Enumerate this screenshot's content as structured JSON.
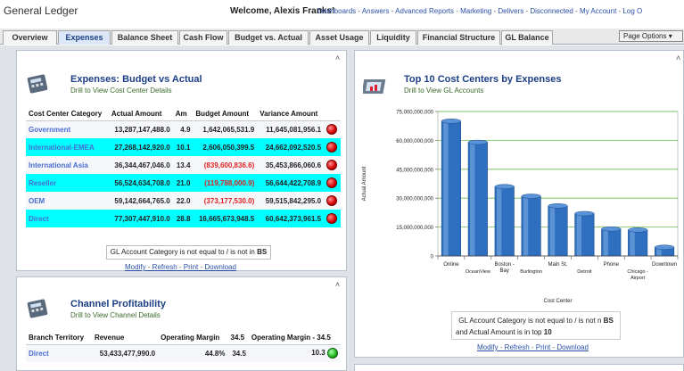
{
  "app": {
    "title": "General Ledger",
    "welcome": "Welcome, Alexis Franks!",
    "links": [
      "Dashboards",
      "Answers",
      "Advanced Reports",
      "Marketing",
      "Delivers",
      "Disconnected",
      "My Account",
      "Log O"
    ]
  },
  "tabs": [
    {
      "label": "Overview"
    },
    {
      "label": "Expenses"
    },
    {
      "label": "Balance Sheet"
    },
    {
      "label": "Cash Flow"
    },
    {
      "label": "Budget vs. Actual"
    },
    {
      "label": "Asset Usage"
    },
    {
      "label": "Liquidity"
    },
    {
      "label": "Financial Structure"
    },
    {
      "label": "GL Balance"
    }
  ],
  "page_options": "Page Options",
  "budget_panel": {
    "title": "Expenses: Budget vs Actual",
    "subtitle": "Drill to View Cost Center Details",
    "headers": [
      "Cost Center Category",
      "Actual Amount",
      "Am",
      "Budget Amount",
      "Variance Amount"
    ],
    "rows": [
      {
        "cat": "Government",
        "actual": "13,287,147,488.0",
        "am": "4.9",
        "budget": "1,642,065,531.9",
        "variance": "11,645,081,956.1"
      },
      {
        "cat": "International-EMEA",
        "actual": "27,268,142,920.0",
        "am": "10.1",
        "budget": "2,606,050,399.5",
        "variance": "24,662,092,520.5"
      },
      {
        "cat": "International Asia",
        "actual": "36,344,467,046.0",
        "am": "13.4",
        "budget": "(839,600,836.6)",
        "variance": "35,453,866,060.6"
      },
      {
        "cat": "Reseller",
        "actual": "56,524,634,708.0",
        "am": "21.0",
        "budget": "(119,788,000.9)",
        "variance": "56,644,422,708.9"
      },
      {
        "cat": "OEM",
        "actual": "59,142,664,765.0",
        "am": "22.0",
        "budget": "(373,177,530.0)",
        "variance": "59,515,842,295.0"
      },
      {
        "cat": "Direct",
        "actual": "77,307,447,910.0",
        "am": "28.8",
        "budget": "16,665,673,948.5",
        "variance": "60,642,373,961.5"
      }
    ],
    "filter_text": "GL Account Category is not equal to / is not in",
    "filter_value": "BS",
    "actions": [
      "Modify",
      "Refresh",
      "Print",
      "Download"
    ]
  },
  "channel_panel": {
    "title": "Channel Profitability",
    "subtitle": "Drill to View Channel Details",
    "headers": [
      "Branch Territory",
      "Revenue",
      "Operating Margin",
      "34.5",
      "Operating Margin - 34.5"
    ],
    "rows": [
      {
        "cat": "Direct",
        "revenue": "53,433,477,990.0",
        "om": "44.8%",
        "v": "34.5",
        "omv": "10.3"
      }
    ]
  },
  "cost_panel": {
    "title": "Top 10 Cost Centers by Expenses",
    "subtitle": "Drill to View GL Accounts",
    "filter_line1": "GL Account Category is not equal to / is not n",
    "filter_value1": "BS",
    "filter_line2": "and Actual Amount is in top",
    "filter_value2": "10",
    "actions": [
      "Modify",
      "Refresh",
      "Print",
      "Download"
    ]
  },
  "chart_data": {
    "type": "bar",
    "title": "",
    "xlabel": "Cost Center",
    "ylabel": "Actual Amount",
    "ylim": [
      0,
      75000000000
    ],
    "yticks": [
      "0",
      "15,000,000,000",
      "30,000,000,000",
      "45,000,000,000",
      "60,000,000,000",
      "75,000,000,000"
    ],
    "categories_upper": [
      "Online",
      "Boston - Bay",
      "Main St.",
      "Phone",
      "Downtown"
    ],
    "categories_lower": [
      "OceanView",
      "Burlington",
      "Detroit",
      "Chicago - Airport"
    ],
    "values": [
      70000000000,
      59000000000,
      36000000000,
      31000000000,
      26000000000,
      22000000000,
      14000000000,
      13500000000,
      4500000000
    ],
    "bar_color": "#2f6fbf",
    "grid": true
  }
}
